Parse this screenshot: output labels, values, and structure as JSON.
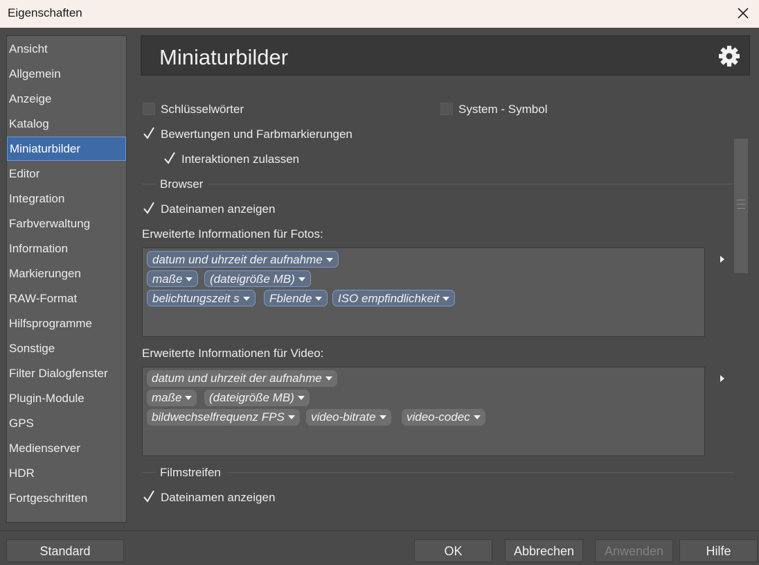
{
  "window": {
    "title": "Eigenschaften"
  },
  "sidebar": {
    "items": [
      {
        "label": "Ansicht"
      },
      {
        "label": "Allgemein"
      },
      {
        "label": "Anzeige"
      },
      {
        "label": "Katalog"
      },
      {
        "label": "Miniaturbilder",
        "active": true
      },
      {
        "label": "Editor"
      },
      {
        "label": "Integration"
      },
      {
        "label": "Farbverwaltung"
      },
      {
        "label": "Information"
      },
      {
        "label": "Markierungen"
      },
      {
        "label": "RAW-Format"
      },
      {
        "label": "Hilfsprogramme"
      },
      {
        "label": "Sonstige"
      },
      {
        "label": "Filter Dialogfenster"
      },
      {
        "label": "Plugin-Module"
      },
      {
        "label": "GPS"
      },
      {
        "label": "Medienserver"
      },
      {
        "label": "HDR"
      },
      {
        "label": "Fortgeschritten"
      }
    ]
  },
  "panel": {
    "title": "Miniaturbilder",
    "options": {
      "keywords": {
        "label": "Schlüsselwörter",
        "checked": false
      },
      "system_symbol": {
        "label": "System - Symbol",
        "checked": false
      },
      "ratings": {
        "label": "Bewertungen und Farbmarkierungen",
        "checked": true
      },
      "interactions": {
        "label": "Interaktionen zulassen",
        "checked": true
      }
    },
    "browser": {
      "section_label": "Browser",
      "show_filenames": {
        "label": "Dateinamen anzeigen",
        "checked": true
      },
      "photos_label": "Erweiterte Informationen für Fotos:",
      "photo_tags": [
        [
          "datum und uhrzeit der aufnahme"
        ],
        [
          "maße",
          "(dateigröße MB)"
        ],
        [
          "belichtungszeit s",
          "Fblende",
          "ISO empfindlichkeit"
        ]
      ],
      "video_label": "Erweiterte Informationen für Video:",
      "video_tags": [
        [
          "datum und uhrzeit der aufnahme"
        ],
        [
          "maße",
          "(dateigröße MB)"
        ],
        [
          "bildwechselfrequenz FPS",
          "video-bitrate",
          "video-codec"
        ]
      ]
    },
    "filmstrip": {
      "section_label": "Filmstreifen",
      "show_filenames": {
        "label": "Dateinamen anzeigen",
        "checked": true
      }
    }
  },
  "footer": {
    "standard": "Standard",
    "ok": "OK",
    "cancel": "Abbrechen",
    "apply": "Anwenden",
    "help": "Hilfe"
  },
  "colors": {
    "accent": "#3e6ba7",
    "tag_selected": "#5f6f86",
    "background": "#4a4a4a"
  }
}
